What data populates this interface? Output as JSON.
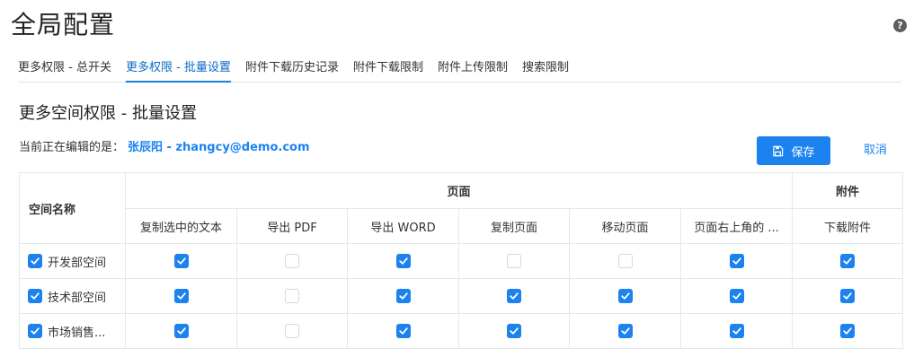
{
  "page": {
    "title": "全局配置",
    "help_icon": "?"
  },
  "tabs": [
    {
      "label": "更多权限 - 总开关",
      "active": false
    },
    {
      "label": "更多权限 - 批量设置",
      "active": true
    },
    {
      "label": "附件下载历史记录",
      "active": false
    },
    {
      "label": "附件下载限制",
      "active": false
    },
    {
      "label": "附件上传限制",
      "active": false
    },
    {
      "label": "搜索限制",
      "active": false
    }
  ],
  "section": {
    "title": "更多空间权限 - 批量设置",
    "editing_label": "当前正在编辑的是：",
    "editing_user": "张辰阳 - zhangcy@demo.com"
  },
  "actions": {
    "save_label": "保存",
    "cancel_label": "取消"
  },
  "table": {
    "space_header": "空间名称",
    "groups": [
      {
        "label": "页面"
      },
      {
        "label": "附件"
      }
    ],
    "columns": [
      "复制选中的文本",
      "导出 PDF",
      "导出 WORD",
      "复制页面",
      "移动页面",
      "页面右上角的 ...",
      "下载附件"
    ],
    "rows": [
      {
        "name": "开发部空间",
        "checked": true,
        "perms": [
          true,
          false,
          true,
          false,
          false,
          true,
          true
        ]
      },
      {
        "name": "技术部空间",
        "checked": true,
        "perms": [
          true,
          false,
          true,
          true,
          true,
          true,
          true
        ]
      },
      {
        "name": "市场销售...",
        "checked": true,
        "perms": [
          true,
          false,
          true,
          true,
          true,
          true,
          true
        ]
      }
    ]
  },
  "colors": {
    "accent": "#1b82f0",
    "tab_active": "#0c6bc9",
    "border": "#e4e7eb"
  }
}
